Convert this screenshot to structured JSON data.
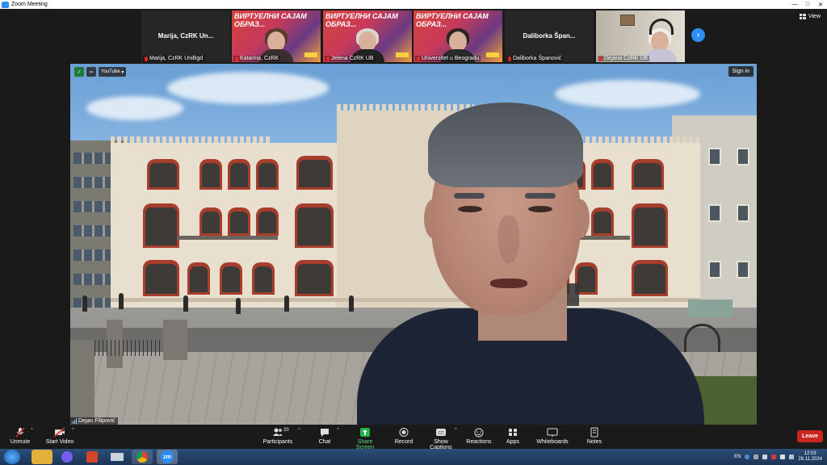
{
  "window": {
    "title": "Zoom Meeting"
  },
  "topbar": {
    "view_label": "View"
  },
  "gallery": [
    {
      "type": "name",
      "name": "Marija,  CzRK  Un...",
      "label": "Marija,  CzRK UniBgd",
      "muted": true
    },
    {
      "type": "banner",
      "banner_text": "ВИРТУЕЛНИ САЈАМ ОБРАЗ...",
      "label": "Katarina, CzRK",
      "muted": true,
      "hair": "#5a3a2a",
      "body": "#3a2d2d"
    },
    {
      "type": "banner",
      "banner_text": "ВИРТУЕЛНИ САЈАМ ОБРАЗ...",
      "label": "Jelena CzRK UB",
      "muted": true,
      "hair": "#d9d4cf",
      "body": "#222222"
    },
    {
      "type": "banner",
      "banner_text": "ВИРТУЕЛНИ САЈАМ ОБРАЗ...",
      "label": "Univerzitet u Beogradu",
      "muted": true,
      "hair": "#2b2421",
      "body": "#2a2a2a"
    },
    {
      "type": "name",
      "name": "Daliborka  Špan...",
      "label": "Daliborka Španović",
      "muted": true
    },
    {
      "type": "video",
      "label": "Dejana CzRK UB",
      "muted": true
    }
  ],
  "main_video": {
    "overlay_source": "YouTube",
    "signin_label": "Sign in",
    "speaker_name": "Dejan Filipović"
  },
  "toolbar": {
    "unmute": "Unmute",
    "start_video": "Start Video",
    "participants": "Participants",
    "participants_count": "20",
    "chat": "Chat",
    "share_screen": "Share Screen",
    "record": "Record",
    "show_captions": "Show Captions",
    "reactions": "Reactions",
    "apps": "Apps",
    "whiteboards": "Whiteboards",
    "notes": "Notes",
    "leave": "Leave"
  },
  "taskbar": {
    "apps": [
      "windows-explorer",
      "viber",
      "powerpoint",
      "network-drive",
      "chrome",
      "zoom"
    ],
    "zoom_label": "zm",
    "language": "EN",
    "time": "12:03",
    "date": "26.11.2024"
  },
  "colors": {
    "zoom_blue": "#2d8cff",
    "leave_red": "#c8261f",
    "share_green": "#23b34a"
  }
}
